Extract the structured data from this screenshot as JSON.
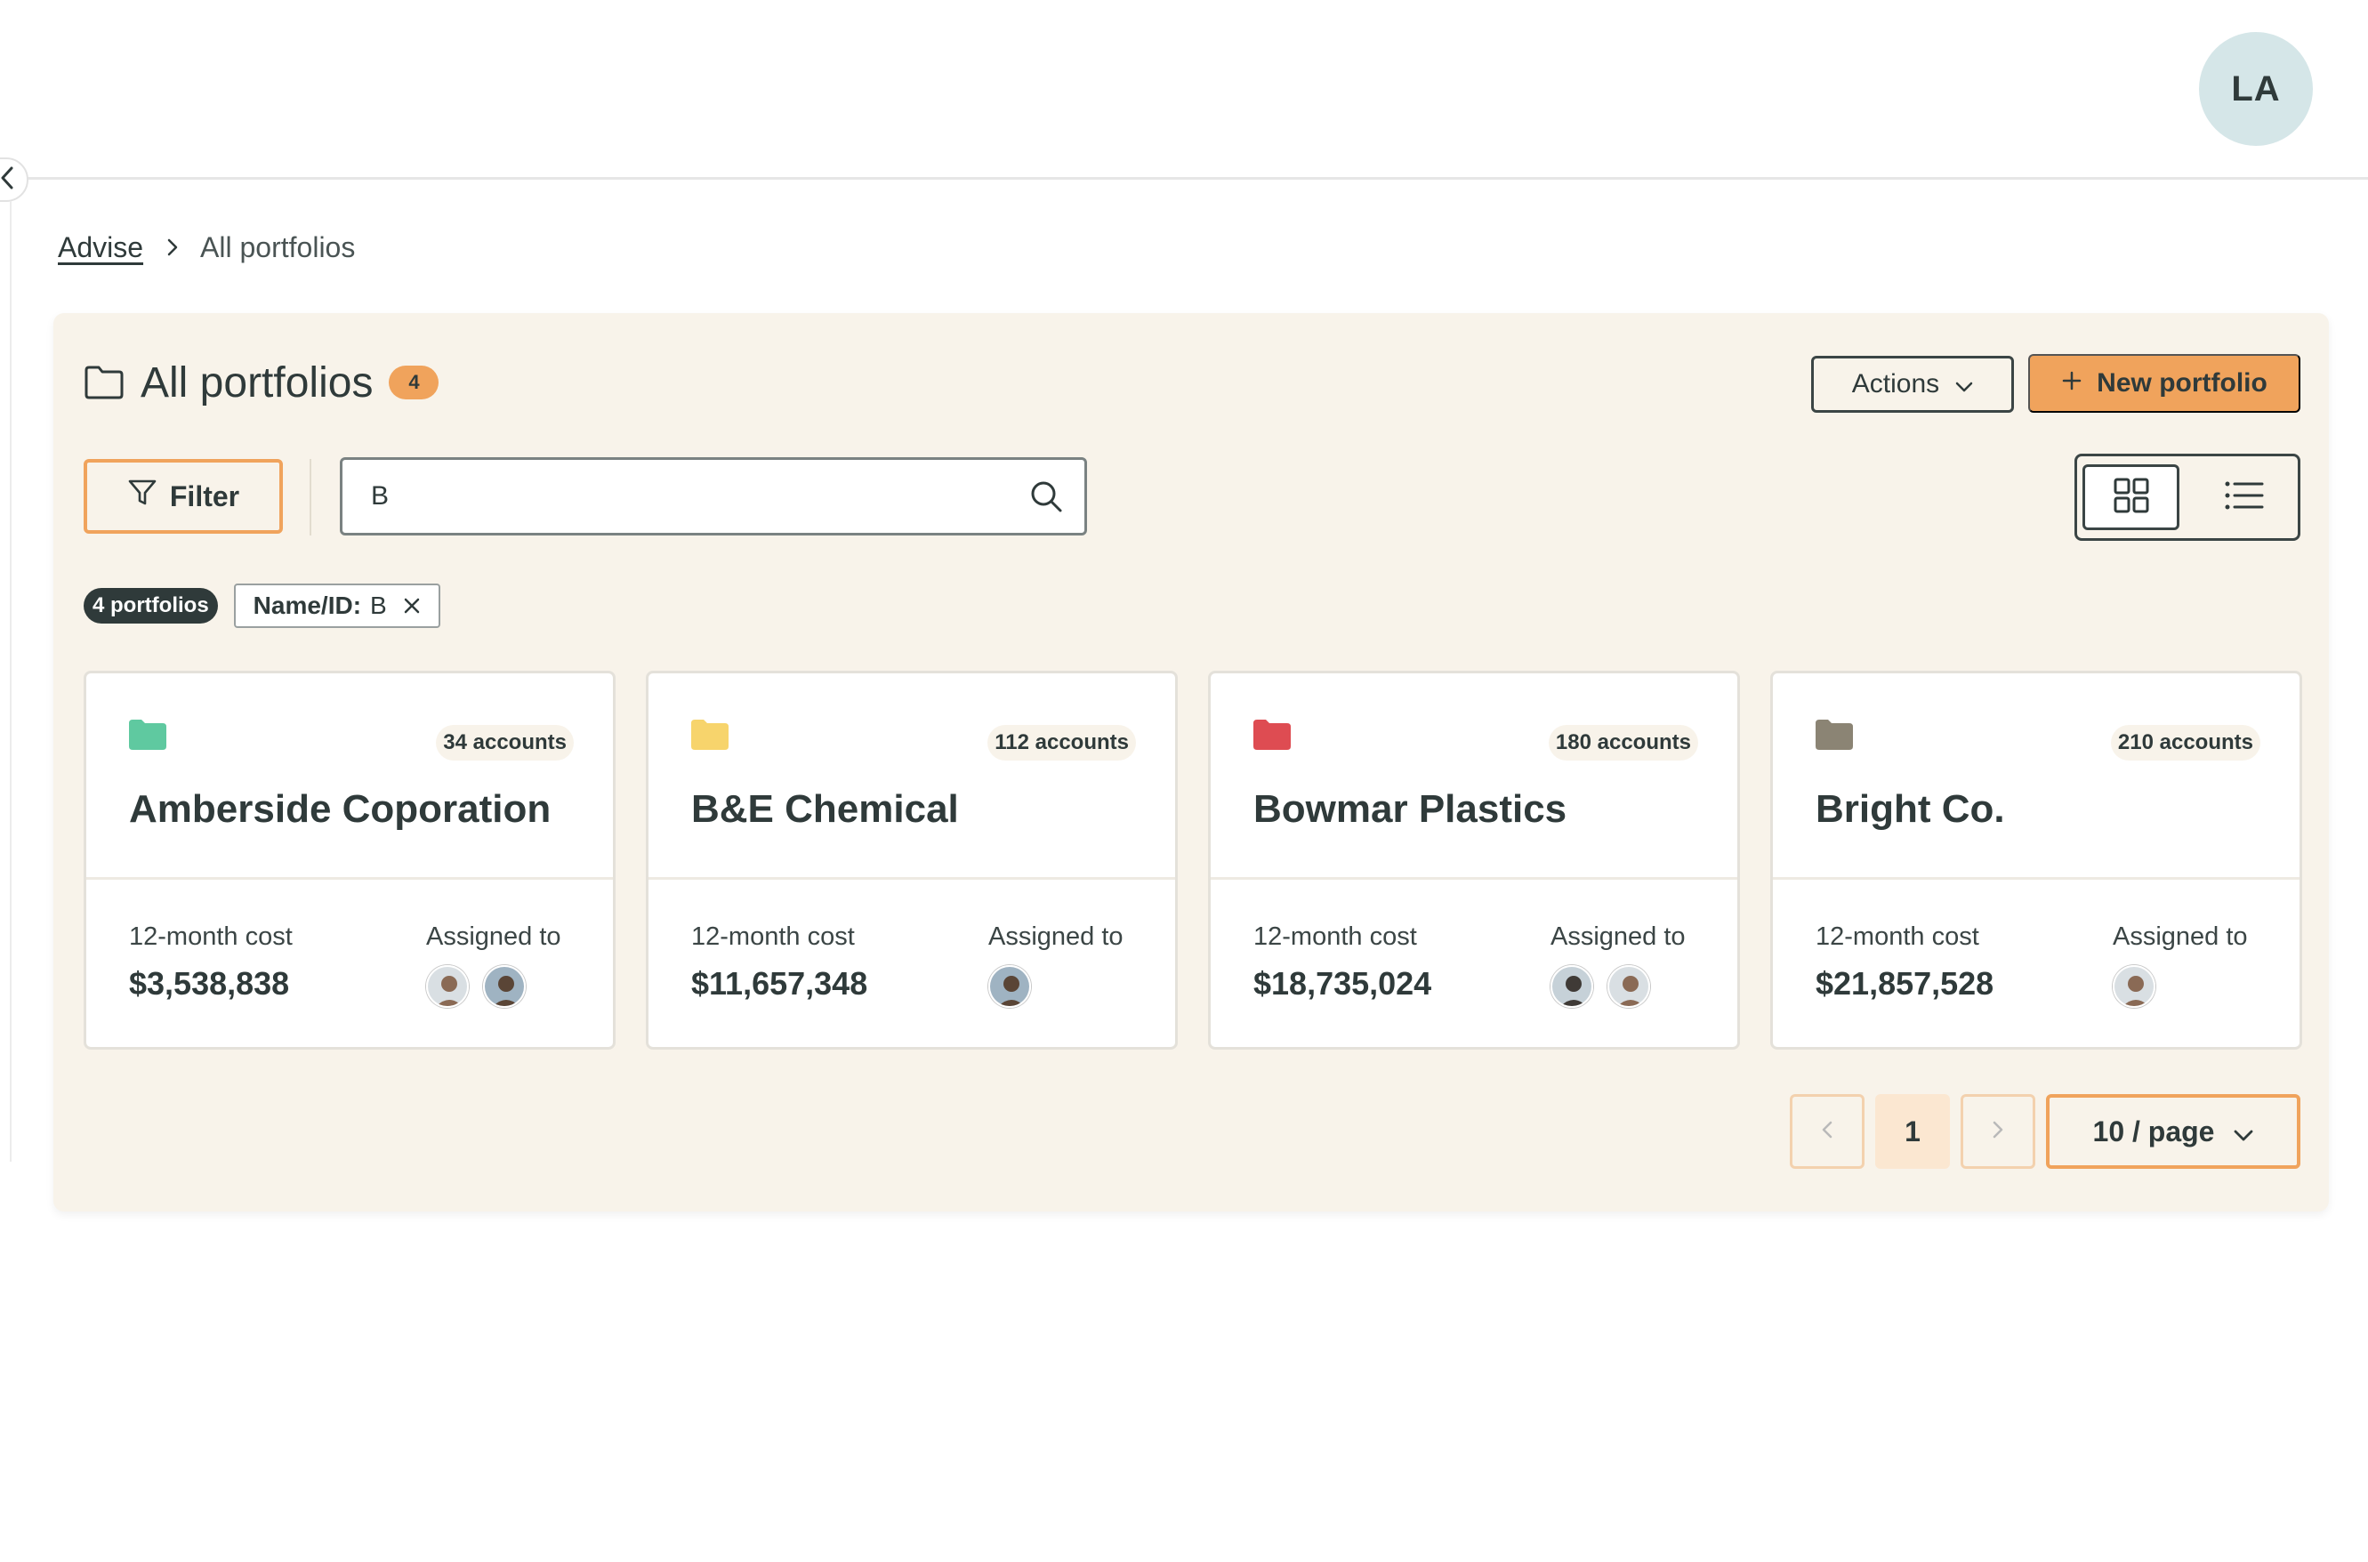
{
  "header": {
    "user_initials": "LA"
  },
  "breadcrumb": {
    "root": "Advise",
    "current": "All portfolios"
  },
  "page": {
    "title": "All portfolios",
    "count": "4",
    "actions_label": "Actions",
    "new_label": "New portfolio"
  },
  "toolbar": {
    "filter_label": "Filter",
    "search_value": "B"
  },
  "chips": {
    "result_count": "4 portfolios",
    "filter_key": "Name/ID:",
    "filter_value": "B"
  },
  "cards": [
    {
      "name": "Amberside Coporation",
      "accounts": "34 accounts",
      "folder_color": "#5fc9a0",
      "cost_label": "12-month cost",
      "cost": "$3,538,838",
      "assigned_label": "Assigned to",
      "assignees": 2
    },
    {
      "name": "B&E Chemical",
      "accounts": "112 accounts",
      "folder_color": "#f7d46c",
      "cost_label": "12-month cost",
      "cost": "$11,657,348",
      "assigned_label": "Assigned to",
      "assignees": 1
    },
    {
      "name": "Bowmar Plastics",
      "accounts": "180 accounts",
      "folder_color": "#de4c52",
      "cost_label": "12-month cost",
      "cost": "$18,735,024",
      "assigned_label": "Assigned to",
      "assignees": 2
    },
    {
      "name": "Bright Co.",
      "accounts": "210 accounts",
      "folder_color": "#8b8474",
      "cost_label": "12-month cost",
      "cost": "$21,857,528",
      "assigned_label": "Assigned to",
      "assignees": 1
    }
  ],
  "pagination": {
    "current_page": "1",
    "page_size": "10 / page"
  },
  "colors": {
    "accent": "#f0a35c",
    "panel_bg": "#f8f3ea",
    "text": "#2f3a3a"
  }
}
